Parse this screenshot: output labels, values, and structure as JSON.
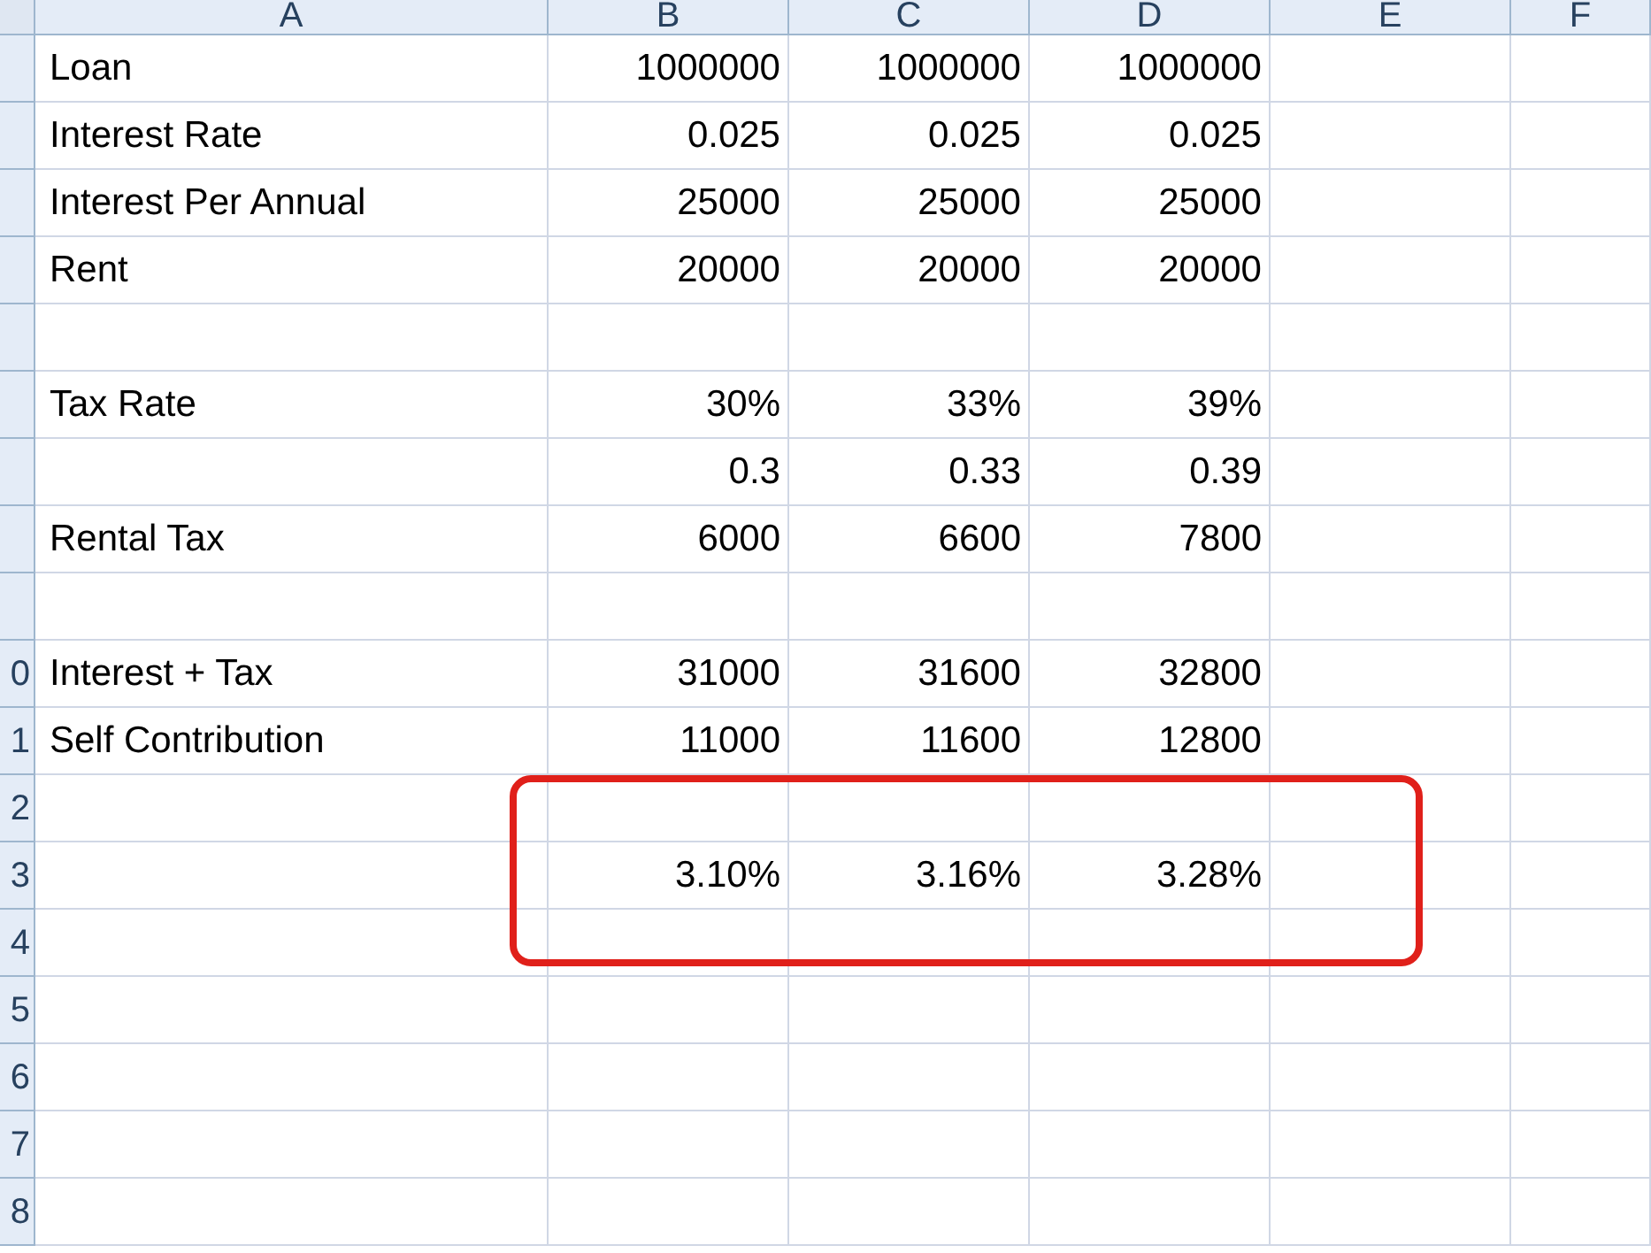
{
  "columns": [
    "A",
    "B",
    "C",
    "D",
    "E",
    "F"
  ],
  "rows": [
    {
      "header": "",
      "cells": [
        "Loan",
        "1000000",
        "1000000",
        "1000000"
      ]
    },
    {
      "header": "",
      "cells": [
        "Interest Rate",
        "0.025",
        "0.025",
        "0.025"
      ]
    },
    {
      "header": "",
      "cells": [
        "Interest Per Annual",
        "25000",
        "25000",
        "25000"
      ]
    },
    {
      "header": "",
      "cells": [
        "Rent",
        "20000",
        "20000",
        "20000"
      ]
    },
    {
      "header": "",
      "cells": [
        "",
        "",
        "",
        ""
      ]
    },
    {
      "header": "",
      "cells": [
        "Tax Rate",
        "30%",
        "33%",
        "39%"
      ]
    },
    {
      "header": "",
      "cells": [
        "",
        "0.3",
        "0.33",
        "0.39"
      ]
    },
    {
      "header": "",
      "cells": [
        "Rental Tax",
        "6000",
        "6600",
        "7800"
      ]
    },
    {
      "header": "",
      "cells": [
        "",
        "",
        "",
        ""
      ]
    },
    {
      "header": "0",
      "cells": [
        "Interest + Tax",
        "31000",
        "31600",
        "32800"
      ]
    },
    {
      "header": "1",
      "cells": [
        "Self Contribution",
        "11000",
        "11600",
        "12800"
      ]
    },
    {
      "header": "2",
      "cells": [
        "",
        "",
        "",
        ""
      ]
    },
    {
      "header": "3",
      "cells": [
        "",
        "3.10%",
        "3.16%",
        "3.28%"
      ]
    },
    {
      "header": "4",
      "cells": [
        "",
        "",
        "",
        ""
      ]
    },
    {
      "header": "5",
      "cells": [
        "",
        "",
        "",
        ""
      ]
    },
    {
      "header": "6",
      "cells": [
        "",
        "",
        "",
        ""
      ]
    },
    {
      "header": "7",
      "cells": [
        "",
        "",
        "",
        ""
      ]
    },
    {
      "header": "8",
      "cells": [
        "",
        "",
        "",
        ""
      ]
    }
  ]
}
